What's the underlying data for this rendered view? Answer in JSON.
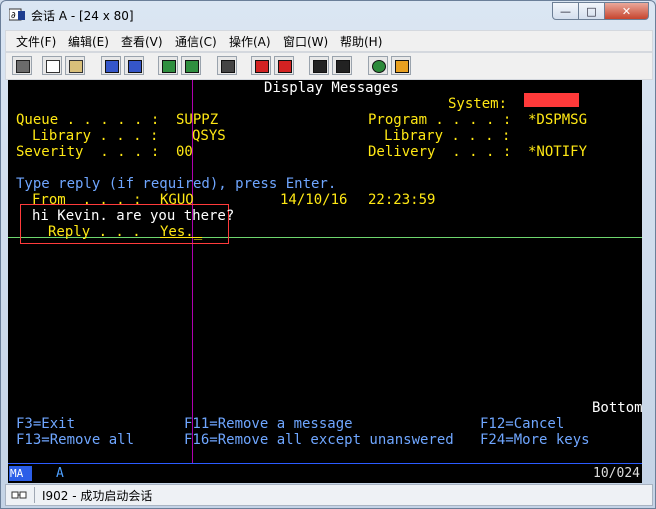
{
  "window": {
    "title": "会话 A - [24 x 80]",
    "minimize_label": "—",
    "maximize_label": "□",
    "close_label": "✕"
  },
  "menu": [
    "文件(F)",
    "编辑(E)",
    "查看(V)",
    "通信(C)",
    "操作(A)",
    "窗口(W)",
    "帮助(H)"
  ],
  "toolbar_icons": [
    "print-screen-icon",
    "copy-icon",
    "paste-icon",
    "send-file-icon",
    "receive-file-icon",
    "display-keypad-icon",
    "macro-keypad-icon",
    "quick-macro-icon",
    "record-macro-icon",
    "stop-macro-icon",
    "play-macro-icon",
    "pause-macro-icon",
    "globe-help-icon",
    "edit-pencil-icon"
  ],
  "terminal": {
    "header": "Display Messages",
    "system_label": "System:",
    "queue_label": "Queue . . . . . :",
    "queue_value": "SUPPZ",
    "library_label": "Library . . . :",
    "library_value": "QSYS",
    "severity_label": "Severity  . . . :",
    "severity_value": "00",
    "program_label": "Program . . . . :",
    "program_value": "*DSPMSG",
    "program_library_label": "Library . . . :",
    "delivery_label": "Delivery  . . . :",
    "delivery_value": "*NOTIFY",
    "instructions": "Type reply (if required), press Enter.",
    "from_label": "From  . . . :",
    "from_value": "KGUO",
    "date": "14/10/16",
    "time": "22:23:59",
    "message": "hi Kevin. are you there?",
    "reply_label": "Reply . . .",
    "reply_value": "Yes._",
    "bottom": "Bottom",
    "f3": "F3=Exit",
    "f11": "F11=Remove a message",
    "f12": "F12=Cancel",
    "f13": "F13=Remove all",
    "f16": "F16=Remove all except unanswered",
    "f24": "F24=More keys"
  },
  "oia": {
    "mode": "MA",
    "session": "A",
    "cursor_pos": "10/024"
  },
  "status": {
    "text": "I902 - 成功启动会话"
  },
  "colors": {
    "terminal_bg": "#000000",
    "green": "#57e357",
    "blue": "#6fa6ff",
    "yellow": "#ffe814",
    "highlight_box": "#ff3b3b",
    "oia_accent": "#2b5ee8"
  }
}
